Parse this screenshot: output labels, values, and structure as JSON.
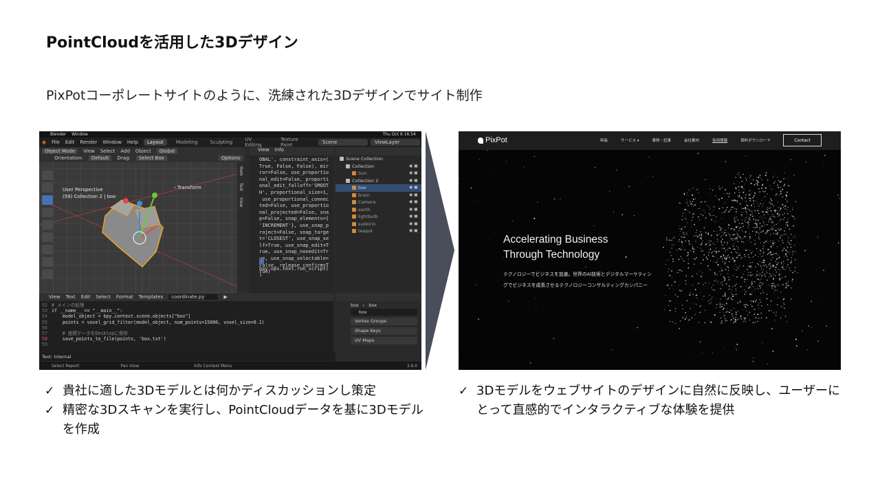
{
  "title": "PointCloudを活用した3Dデザイン",
  "subtitle": "PixPotコーポレートサイトのように、洗練された3Dデザインでサイト制作",
  "blender": {
    "app_name": "Blender",
    "menu_window": "Window",
    "clock": "Thu Oct 6 16:54",
    "menu": [
      "File",
      "Edit",
      "Render",
      "Window",
      "Help"
    ],
    "workspaces": [
      "Layout",
      "Modeling",
      "Sculpting",
      "UV Editing",
      "Texture Paint"
    ],
    "scene": "Scene",
    "view_layer": "ViewLayer",
    "viewport_header": [
      "Object Mode",
      "View",
      "Select",
      "Add",
      "Object",
      "Global"
    ],
    "orientation_label": "Orientation:",
    "orientation_value": "Default",
    "drag_label": "Drag:",
    "drag_value": "Select Box",
    "options": "Options",
    "viewport_title": "User Perspective",
    "viewport_sub": "(59) Collection 2 | box",
    "transform": "Transform",
    "side_tabs": [
      "Item",
      "Tool",
      "View"
    ],
    "info_header": [
      "View",
      "Info"
    ],
    "info_code": "OBAL', constraint_axis=(\nTrue, False, False), mir\nror=False, use_proportio\nnal_edit=False, proporti\nonal_edit_falloff='SMOOT\nH', proportional_size=1,\n use_proportional_connec\nted=False, use_proportio\nnal_projected=False, sna\np=False, snap_elements={\n'INCREMENT'}, use_snap_p\nroject=False, snap_targe\nt='CLOSEST', use_snap_se\nlf=True, use_snap_edit=T\nrue, use_snap_nonedit=Tr\nue, use_snap_selectable=\nFalse, release_confirm=T\nrue)",
    "info_op": "bpy.ops.text.run_script(\n)",
    "outliner": [
      {
        "name": "Scene Collection",
        "kind": "col",
        "indent": 0
      },
      {
        "name": "Collection",
        "kind": "col",
        "indent": 1
      },
      {
        "name": "Sun",
        "kind": "obj",
        "indent": 2
      },
      {
        "name": "Collection 2",
        "kind": "col",
        "indent": 1
      },
      {
        "name": "box",
        "kind": "obj",
        "indent": 2,
        "selected": true
      },
      {
        "name": "brain",
        "kind": "obj",
        "indent": 2
      },
      {
        "name": "Camera",
        "kind": "obj",
        "indent": 2
      },
      {
        "name": "earth",
        "kind": "obj",
        "indent": 2
      },
      {
        "name": "lightbulb",
        "kind": "obj",
        "indent": 2
      },
      {
        "name": "sukkirin",
        "kind": "obj",
        "indent": 2
      },
      {
        "name": "teapot",
        "kind": "obj",
        "indent": 2
      }
    ],
    "editor_header": [
      "View",
      "Text",
      "Edit",
      "Select",
      "Format",
      "Templates"
    ],
    "editor_file": "coordinate.py",
    "code_lines": [
      {
        "n": "52",
        "t": "# メインの処理",
        "c": true
      },
      {
        "n": "53",
        "t": "if __name__ == \"__main__\":"
      },
      {
        "n": "54",
        "t": "    model_object = bpy.context.scene.objects[\"box\"]"
      },
      {
        "n": "55",
        "t": "    points = voxel_grid_filter(model_object, num_points=15000, voxel_size=0.1)"
      },
      {
        "n": "56",
        "t": ""
      },
      {
        "n": "57",
        "t": "    # 座標データをDesktopに保存",
        "c": true
      },
      {
        "n": "58",
        "t": "    save_points_to_file(points, 'box.txt')",
        "e": true
      },
      {
        "n": "59",
        "t": ""
      }
    ],
    "props_object": "box",
    "props_mesh": "box",
    "props_data": "box",
    "props_groups": [
      "Vertex Groups",
      "Shape Keys",
      "UV Maps"
    ],
    "status_text": "Text: Internal",
    "statusbar": [
      "Select Report",
      "Pan View",
      "Info Context Menu"
    ],
    "version": "3.6.0"
  },
  "web": {
    "logo": "PixPot",
    "nav": [
      "特長",
      "サービス ▾",
      "事例・記事",
      "会社案内",
      "採用情報",
      "資料ダウンロード"
    ],
    "contact": "Contact",
    "headline_1": "Accelerating Business",
    "headline_2": "Through Technology",
    "copy": "テクノロジーでビジネスを加速。世界のAI技術とデジタルマーケティングでビジネスを成長させるテクノロジーコンサルティングカンパニー"
  },
  "bullets_left": [
    "貴社に適した3Dモデルとは何かディスカッションし策定",
    "精密な3Dスキャンを実行し、PointCloudデータを基に3Dモデルを作成"
  ],
  "bullets_right": [
    "3Dモデルをウェブサイトのデザインに自然に反映し、ユーザーにとって直感的でインタラクティブな体験を提供"
  ],
  "colors": {
    "blender_bg": "#2a2a2a",
    "blender_select": "#344d73",
    "object_outline": "#e8a030",
    "web_bg": "#050505",
    "arrow": "#4a4d5a"
  }
}
